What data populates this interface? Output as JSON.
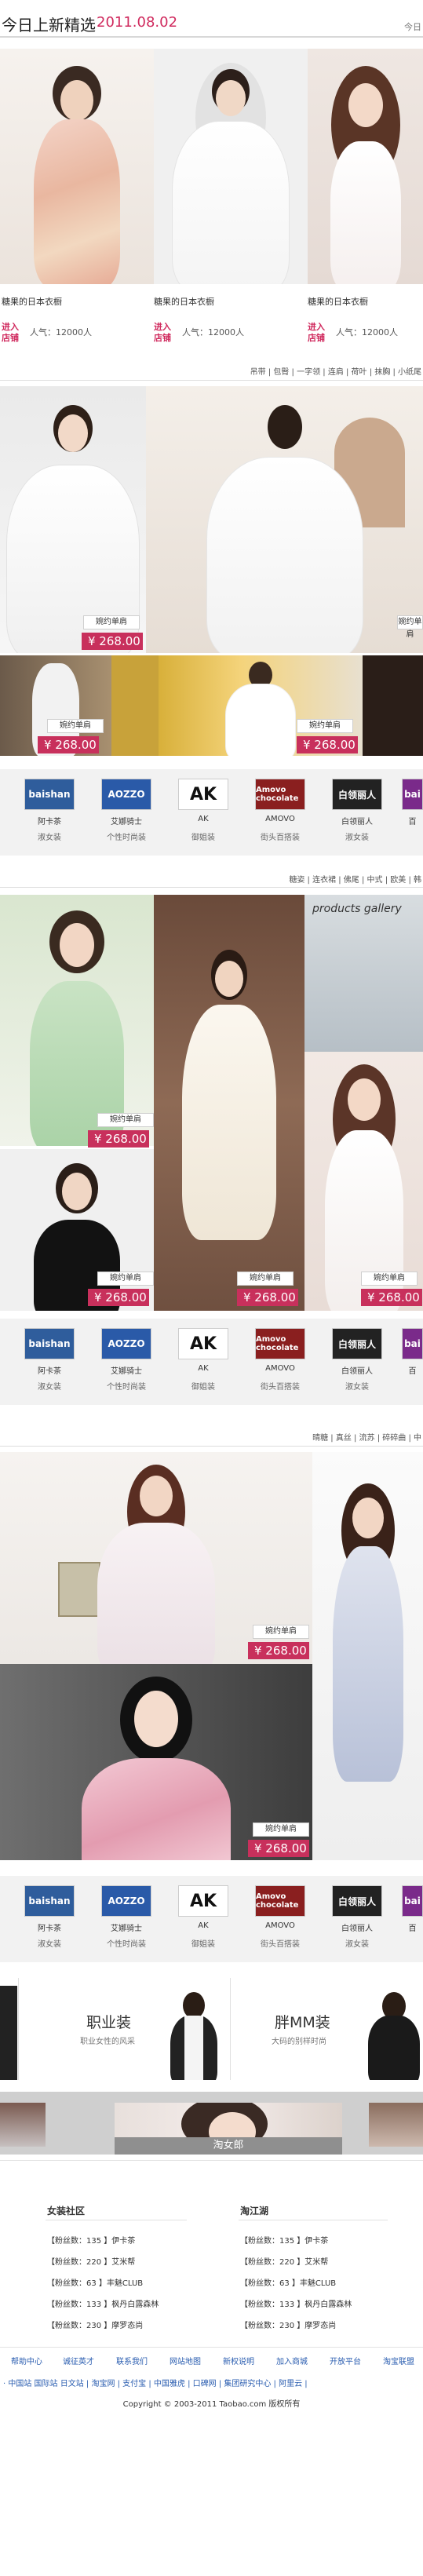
{
  "header": {
    "title": "今日上新精选",
    "date": "2011.08.02",
    "more": "今日"
  },
  "section1": {
    "products": [
      {
        "name": "糖果的日本衣橱",
        "enter": "进入店铺",
        "popularity": "人气：12000人"
      },
      {
        "name": "糖果的日本衣橱",
        "enter": "进入店铺",
        "popularity": "人气：12000人"
      },
      {
        "name": "糖果的日本衣橱",
        "enter": "进入店铺",
        "popularity": "人气：12000人"
      }
    ],
    "tags": "吊带 | 包臀 | 一字领 | 连肩 | 荷叶 | 抹胸 | 小纸尾"
  },
  "section2": {
    "shop_labels": [
      "婉约单肩",
      "婉约单肩",
      "婉约单肩",
      "婉约单肩"
    ],
    "prices": [
      "¥ 268.00",
      "¥ 268.00",
      "¥ 268.00"
    ]
  },
  "brands": [
    {
      "logo": "baishan",
      "name": "阿卡茶",
      "desc": "淑女装",
      "color": "#2f5d9c"
    },
    {
      "logo": "AOZZO",
      "name": "艾娜骑士",
      "desc": "个性时尚装",
      "color": "#2a5aa8"
    },
    {
      "logo": "AK",
      "name": "AK",
      "desc": "御姐装",
      "color": "#ffffff"
    },
    {
      "logo": "Amovo chocolate",
      "name": "AMOVO",
      "desc": "街头百搭装",
      "color": "#8a1f1f"
    },
    {
      "logo": "白领丽人",
      "name": "白领丽人",
      "desc": "淑女装",
      "color": "#222222"
    },
    {
      "logo": "bai",
      "name": "百",
      "desc": "",
      "color": "#7a2a8a"
    }
  ],
  "section3": {
    "tags": "糖姿 | 连衣裙 | 佛尾 | 中式 | 欧美 | 韩",
    "shop_labels": [
      "婉约单肩",
      "婉约单肩",
      "婉约单肩",
      "婉约单肩"
    ],
    "prices": [
      "¥ 268.00",
      "¥ 268.00",
      "¥ 268.00",
      "¥ 268.00"
    ]
  },
  "section4": {
    "tags": "晴糖 | 真丝 | 流苏 | 碎碎曲 | 中",
    "shop_labels": [
      "婉约单肩",
      "婉约单肩"
    ],
    "prices": [
      "¥ 268.00",
      "¥ 268.00"
    ]
  },
  "categories": [
    {
      "title": "职业装",
      "subtitle": "职业女性的风采"
    },
    {
      "title": "胖MM装",
      "subtitle": "大码的别样时尚"
    }
  ],
  "banner": {
    "label": "淘女郎"
  },
  "community": {
    "left_title": "女装社区",
    "right_title": "淘江湖",
    "left_items": [
      "【粉丝数：135 】伊卡茶",
      "【粉丝数：220 】艾米帮",
      "【粉丝数：63 】丰魅CLUB",
      "【粉丝数：133 】枫丹白露森林",
      "【粉丝数：230 】摩罗态尚"
    ],
    "right_items": [
      "【粉丝数：135 】伊卡茶",
      "【粉丝数：220 】艾米帮",
      "【粉丝数：63 】丰魅CLUB",
      "【粉丝数：133 】枫丹白露森林",
      "【粉丝数：230 】摩罗态尚"
    ]
  },
  "footer": {
    "links1": [
      "帮助中心",
      "诚征英才",
      "联系我们",
      "网站地图",
      "新权说明",
      "加入商城",
      "开放平台",
      "淘宝联盟"
    ],
    "links2": "· 中国站 国际站 日文站 | 淘宝网 | 支付宝 | 中国雅虎 | 口碑网 | 集团研究中心 | 阿里云 |",
    "copyright": "Copyright © 2003-2011 Taobao.com 版权所有"
  }
}
